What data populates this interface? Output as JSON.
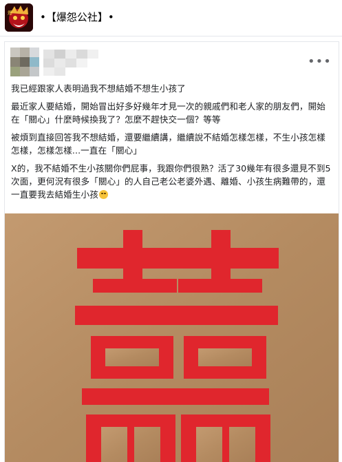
{
  "header": {
    "group_name": "•【爆怨公社】•"
  },
  "post": {
    "more_icon": "more-horizontal-icon",
    "paragraphs": [
      "我已經跟家人表明過我不想結婚不想生小孩了",
      "最近家人要結婚，開始冒出好多好幾年才見一次的親戚們和老人家的朋友們，開始在「關心」什麼時候換我了？怎麼不趕快交一個？等等",
      "被煩到直接回答我不想結婚，還要繼續講，繼續說不結婚怎樣怎樣，不生小孩怎樣怎樣，怎樣怎樣...一直在「關心」",
      "X的，我不結婚不生小孩關你們屁事，我跟你們很熟？活了30幾年有很多還見不到5次面，更何況有很多「關心」的人自己老公老婆外遇、離婚、小孩生病難帶的，還一直要我去結婚生小孩"
    ],
    "emoji_icon": "rolling-eyes-emoji-icon",
    "photo_description_icon": "double-happiness-icon",
    "colors": {
      "cardboard": "#b78f66",
      "symbol_red": "#e0262d"
    }
  }
}
